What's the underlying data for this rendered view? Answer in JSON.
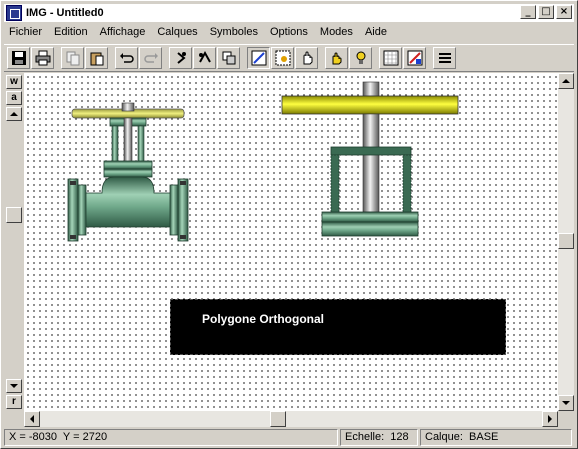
{
  "window": {
    "title": "IMG - Untitled0",
    "controls": {
      "minimize": "_",
      "maximize": "□",
      "close": "×"
    }
  },
  "menu": [
    "Fichier",
    "Edition",
    "Affichage",
    "Calques",
    "Symboles",
    "Options",
    "Modes",
    "Aide"
  ],
  "toolbar": {
    "buttons": [
      {
        "name": "save-icon"
      },
      {
        "name": "print-icon"
      },
      {
        "name": "copy-icon"
      },
      {
        "name": "paste-icon"
      },
      {
        "name": "undo-icon"
      },
      {
        "name": "redo-icon"
      },
      {
        "name": "rotate-icon"
      },
      {
        "name": "flip-icon"
      },
      {
        "name": "group-icon"
      },
      {
        "name": "draw-line-icon"
      },
      {
        "name": "select-icon"
      },
      {
        "name": "hand-icon"
      },
      {
        "name": "grab-icon"
      },
      {
        "name": "light-icon"
      },
      {
        "name": "grid-icon"
      },
      {
        "name": "color-icon"
      },
      {
        "name": "menu-icon"
      }
    ]
  },
  "leftstrip": {
    "w_label": "w",
    "a_label": "a",
    "r_label": "r"
  },
  "canvas": {
    "label_text": "Polygone Orthogonal",
    "colors": {
      "valve_body": "#5e9a7a",
      "handle_yellow": "#e8e800",
      "stem_gray": "#9a9a9a",
      "label_bg": "#000000",
      "label_text": "#ffffff"
    }
  },
  "status": {
    "coords": "X = -8030  Y = 2720",
    "scale": "Echelle:  128",
    "layer": "Calque:  BASE"
  }
}
